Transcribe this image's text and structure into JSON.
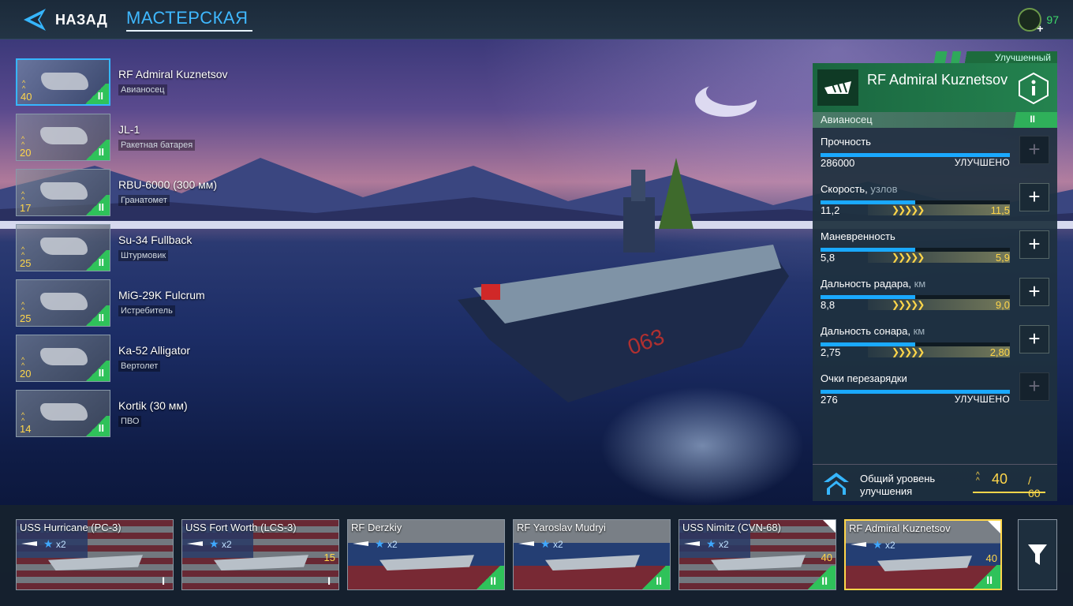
{
  "topbar": {
    "back_label": "НАЗАД",
    "workshop_label": "МАСТЕРСКАЯ",
    "currency_value": "97",
    "currency_icon": "cash-icon"
  },
  "modules": [
    {
      "name": "RF Admiral Kuznetsov",
      "type": "Авианосец",
      "level": "40",
      "tier": "II",
      "selected": true
    },
    {
      "name": "JL-1",
      "type": "Ракетная батарея",
      "level": "20",
      "tier": "II"
    },
    {
      "name": "RBU-6000 (300 мм)",
      "type": "Гранатомет",
      "level": "17",
      "tier": "II"
    },
    {
      "name": "Su-34 Fullback",
      "type": "Штурмовик",
      "level": "25",
      "tier": "II"
    },
    {
      "name": "MiG-29K Fulcrum",
      "type": "Истребитель",
      "level": "25",
      "tier": "II"
    },
    {
      "name": "Ka-52 Alligator",
      "type": "Вертолет",
      "level": "20",
      "tier": "II"
    },
    {
      "name": "Kortik (30 мм)",
      "type": "ПВО",
      "level": "14",
      "tier": "II"
    }
  ],
  "panel": {
    "status": "Улучшенный",
    "title": "RF Admiral Kuznetsov",
    "type": "Авианосец",
    "tier": "II",
    "stats": [
      {
        "name": "Прочность",
        "unit": "",
        "current": "286000",
        "next": "",
        "done": "УЛУЧШЕНО",
        "fill": 1.0
      },
      {
        "name": "Скорость,",
        "unit": " узлов",
        "current": "11,2",
        "next": "11,5",
        "done": "",
        "fill": 0.5
      },
      {
        "name": "Маневренность",
        "unit": "",
        "current": "5,8",
        "next": "5,9",
        "done": "",
        "fill": 0.5
      },
      {
        "name": "Дальность радара,",
        "unit": " км",
        "current": "8,8",
        "next": "9,0",
        "done": "",
        "fill": 0.5
      },
      {
        "name": "Дальность сонара,",
        "unit": " км",
        "current": "2,75",
        "next": "2,80",
        "done": "",
        "fill": 0.5
      },
      {
        "name": "Очки перезарядки",
        "unit": "",
        "current": "276",
        "next": "",
        "done": "УЛУЧШЕНО",
        "fill": 1.0
      }
    ],
    "total_label": "Общий уровень улучшения",
    "total_current": "40",
    "total_sep": "/",
    "total_max": "60"
  },
  "ships": [
    {
      "name": "USS Hurricane (PC-3)",
      "mult": "x2",
      "level": "",
      "tier": "I",
      "flag": "usa"
    },
    {
      "name": "USS Fort Worth (LCS-3)",
      "mult": "x2",
      "level": "15",
      "tier": "I",
      "flag": "usa"
    },
    {
      "name": "RF Derzkiy",
      "mult": "x2",
      "level": "",
      "tier": "II",
      "flag": "ru"
    },
    {
      "name": "RF Yaroslav Mudryi",
      "mult": "x2",
      "level": "",
      "tier": "II",
      "flag": "ru"
    },
    {
      "name": "USS Nimitz (CVN-68)",
      "mult": "x2",
      "level": "40",
      "tier": "II",
      "flag": "usa"
    },
    {
      "name": "RF Admiral Kuznetsov",
      "mult": "x2",
      "level": "40",
      "tier": "II",
      "flag": "ru",
      "selected": true
    }
  ],
  "colors": {
    "accent": "#36b6ff",
    "green": "#2fc25a",
    "gold": "#ffd64a"
  }
}
